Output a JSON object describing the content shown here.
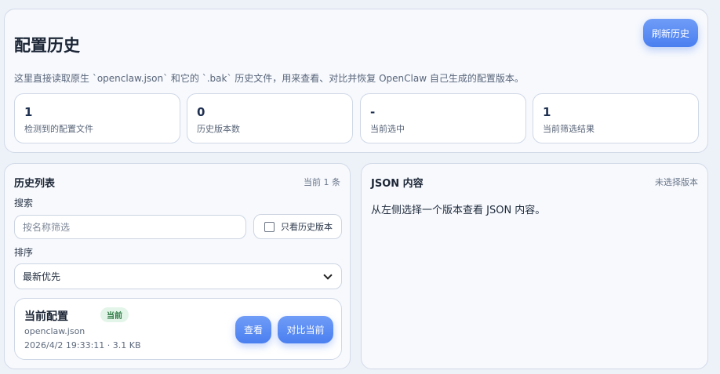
{
  "header": {
    "title": "配置历史",
    "description": "这里直接读取原生 `openclaw.json` 和它的 `.bak` 历史文件，用来查看、对比并恢复 OpenClaw 自己生成的配置版本。",
    "refresh_label": "刷新历史"
  },
  "stats": [
    {
      "value": "1",
      "label": "检测到的配置文件"
    },
    {
      "value": "0",
      "label": "历史版本数"
    },
    {
      "value": "-",
      "label": "当前选中"
    },
    {
      "value": "1",
      "label": "当前筛选结果"
    }
  ],
  "history": {
    "title": "历史列表",
    "count_label": "当前 1 条",
    "search_label": "搜索",
    "search_placeholder": "按名称筛选",
    "only_history_label": "只看历史版本",
    "sort_label": "排序",
    "sort_selected": "最新优先",
    "items": [
      {
        "title": "当前配置",
        "badge": "当前",
        "file": "openclaw.json",
        "meta": "2026/4/2 19:33:11 · 3.1 KB",
        "view_label": "查看",
        "compare_label": "对比当前"
      }
    ]
  },
  "json_panel": {
    "title": "JSON 内容",
    "status": "未选择版本",
    "empty_text": "从左侧选择一个版本查看 JSON 内容。"
  },
  "colors": {
    "accent": "#4a7ff0",
    "badge_bg": "#e2f5e8",
    "badge_text": "#2f7a45"
  }
}
